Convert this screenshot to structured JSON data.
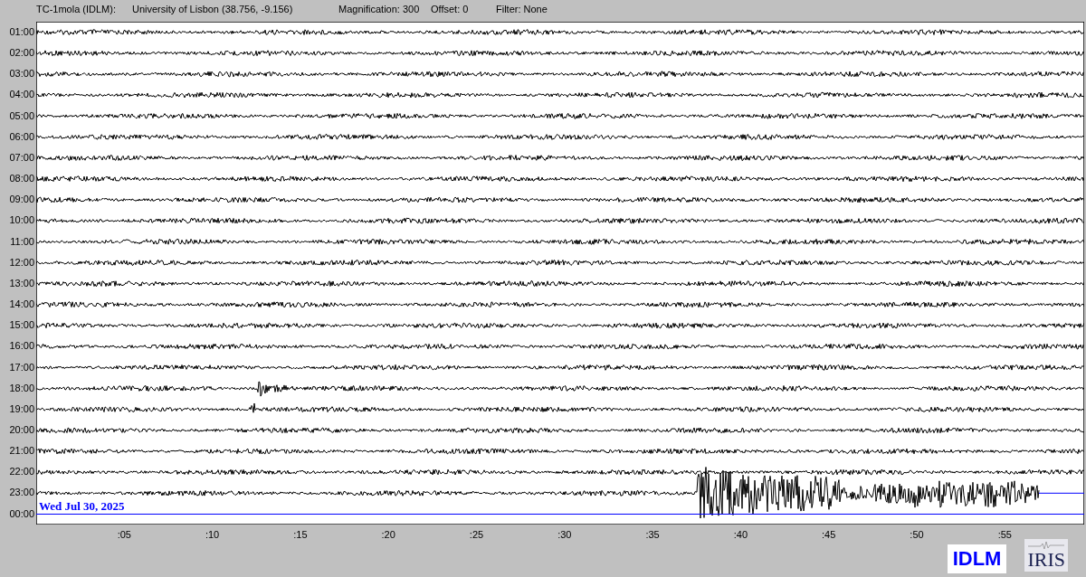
{
  "header": {
    "station": "TC-1mola (IDLM):",
    "location": "University of Lisbon (38.756, -9.156)",
    "magnification": "Magnification: 300",
    "offset": "Offset: 0",
    "filter": "Filter: None"
  },
  "rows": [
    {
      "hour": "01:00",
      "kind": "trace"
    },
    {
      "hour": "02:00",
      "kind": "trace"
    },
    {
      "hour": "03:00",
      "kind": "trace"
    },
    {
      "hour": "04:00",
      "kind": "trace"
    },
    {
      "hour": "05:00",
      "kind": "trace"
    },
    {
      "hour": "06:00",
      "kind": "trace"
    },
    {
      "hour": "07:00",
      "kind": "trace"
    },
    {
      "hour": "08:00",
      "kind": "trace"
    },
    {
      "hour": "09:00",
      "kind": "trace"
    },
    {
      "hour": "10:00",
      "kind": "trace"
    },
    {
      "hour": "11:00",
      "kind": "trace"
    },
    {
      "hour": "12:00",
      "kind": "trace"
    },
    {
      "hour": "13:00",
      "kind": "trace"
    },
    {
      "hour": "14:00",
      "kind": "trace"
    },
    {
      "hour": "15:00",
      "kind": "trace"
    },
    {
      "hour": "16:00",
      "kind": "trace"
    },
    {
      "hour": "17:00",
      "kind": "trace"
    },
    {
      "hour": "18:00",
      "kind": "trace"
    },
    {
      "hour": "19:00",
      "kind": "trace"
    },
    {
      "hour": "20:00",
      "kind": "trace"
    },
    {
      "hour": "21:00",
      "kind": "trace"
    },
    {
      "hour": "22:00",
      "kind": "trace"
    },
    {
      "hour": "23:00",
      "kind": "trace"
    },
    {
      "hour": "00:00",
      "kind": "current"
    }
  ],
  "date_label": "Wed Jul 30, 2025",
  "x_ticks": [
    ":05",
    ":10",
    ":15",
    ":20",
    ":25",
    ":30",
    ":35",
    ":40",
    ":45",
    ":50",
    ":55"
  ],
  "logos": {
    "network": "IDLM",
    "iris": "IRIS"
  }
}
